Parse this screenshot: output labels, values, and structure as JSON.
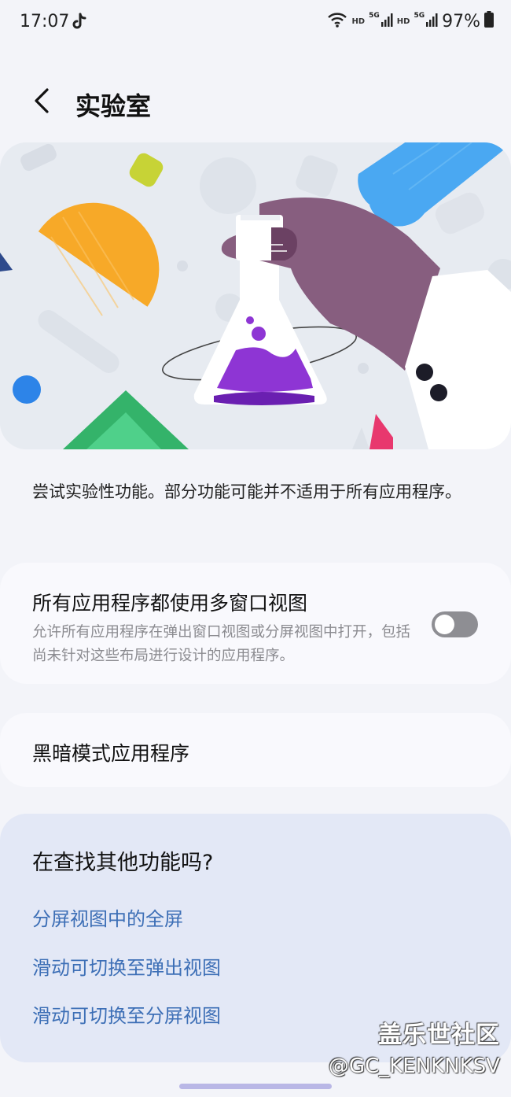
{
  "status": {
    "time": "17:07",
    "hd1": "HD",
    "net1": "5G",
    "hd2": "HD",
    "net2": "5G",
    "battery": "97%"
  },
  "header": {
    "title": "实验室"
  },
  "description": "尝试实验性功能。部分功能可能并不适用于所有应用程序。",
  "settings": [
    {
      "label": "所有应用程序都使用多窗口视图",
      "sub": "允许所有应用程序在弹出窗口视图或分屏视图中打开，包括尚未针对这些布局进行设计的应用程序。",
      "toggle": "off"
    },
    {
      "label": "黑暗模式应用程序"
    }
  ],
  "find": {
    "title": "在查找其他功能吗?",
    "links": [
      "分屏视图中的全屏",
      "滑动可切换至弹出视图",
      "滑动可切换至分屏视图"
    ]
  },
  "watermark": {
    "line1": "盖乐世社区",
    "line2": "@GC_KENKNKSV"
  },
  "colors": {
    "link": "#3d6fb6",
    "toggle_off": "#8e8e93",
    "background": "#f3f4f9"
  }
}
